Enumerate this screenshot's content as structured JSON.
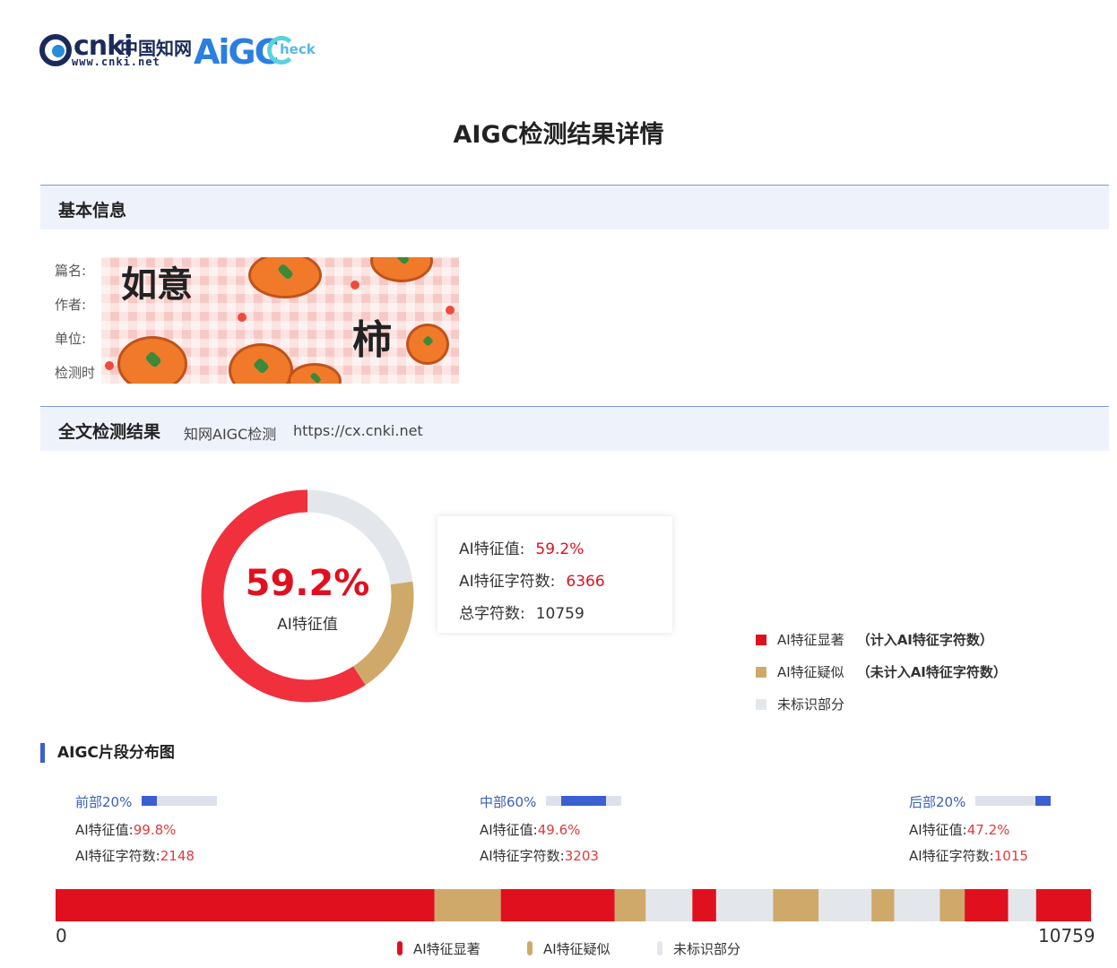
{
  "header": {
    "cnki_text": "cnki",
    "cnki_cn": "中国知网",
    "cnki_url": "www.cnki.net",
    "aigc_logo": "AiGC",
    "check_text": "heck"
  },
  "page_title": "AIGC检测结果详情",
  "basic_info": {
    "section_title": "基本信息",
    "labels": [
      "篇名:",
      "作者:",
      "单位:",
      "检测时"
    ],
    "cover_text": [
      "如意",
      "柿"
    ]
  },
  "full_result": {
    "section_title": "全文检测结果",
    "service_name": "知网AIGC检测",
    "service_url": "https://cx.cnki.net"
  },
  "donut": {
    "center_value": "59.2%",
    "center_label": "AI特征值",
    "segments": [
      {
        "key": "significant",
        "value": 59.2,
        "color": "#f0303c"
      },
      {
        "key": "suspected",
        "value": 18.0,
        "color": "#cfa96a"
      },
      {
        "key": "unmarked",
        "value": 22.8,
        "color": "#e3e6ea"
      }
    ]
  },
  "summary": {
    "ai_value_label": "AI特征值:",
    "ai_value": "59.2%",
    "ai_chars_label": "AI特征字符数:",
    "ai_chars": "6366",
    "total_chars_label": "总字符数:",
    "total_chars": "10759"
  },
  "legend": [
    {
      "label": "AI特征显著",
      "note": "（计入AI特征字符数）",
      "color": "#e0101e"
    },
    {
      "label": "AI特征疑似",
      "note": "（未计入AI特征字符数）",
      "color": "#cfa96a"
    },
    {
      "label": "未标识部分",
      "note": "",
      "color": "#e3e6ea"
    }
  ],
  "distribution": {
    "title": "AIGC片段分布图",
    "segments": [
      {
        "name": "前部20%",
        "ai_value_label": "AI特征值:",
        "ai_value": "99.8%",
        "ai_chars_label": "AI特征字符数:",
        "ai_chars": "2148",
        "fill_start": 0.0,
        "fill_end": 0.2
      },
      {
        "name": "中部60%",
        "ai_value_label": "AI特征值:",
        "ai_value": "49.6%",
        "ai_chars_label": "AI特征字符数:",
        "ai_chars": "3203",
        "fill_start": 0.2,
        "fill_end": 0.8
      },
      {
        "name": "后部20%",
        "ai_value_label": "AI特征值:",
        "ai_value": "47.2%",
        "ai_chars_label": "AI特征字符数:",
        "ai_chars": "1015",
        "fill_start": 0.8,
        "fill_end": 1.0
      }
    ],
    "strip_start": "0",
    "strip_end": "10759",
    "strip_blocks": [
      {
        "type": "significant",
        "from": 0.0,
        "to": 0.366
      },
      {
        "type": "suspected",
        "from": 0.366,
        "to": 0.43
      },
      {
        "type": "significant",
        "from": 0.43,
        "to": 0.54
      },
      {
        "type": "suspected",
        "from": 0.54,
        "to": 0.57
      },
      {
        "type": "unmarked",
        "from": 0.57,
        "to": 0.615
      },
      {
        "type": "significant",
        "from": 0.615,
        "to": 0.638
      },
      {
        "type": "unmarked",
        "from": 0.638,
        "to": 0.693
      },
      {
        "type": "suspected",
        "from": 0.693,
        "to": 0.737
      },
      {
        "type": "unmarked",
        "from": 0.737,
        "to": 0.788
      },
      {
        "type": "suspected",
        "from": 0.788,
        "to": 0.81
      },
      {
        "type": "unmarked",
        "from": 0.81,
        "to": 0.854
      },
      {
        "type": "suspected",
        "from": 0.854,
        "to": 0.878
      },
      {
        "type": "significant",
        "from": 0.878,
        "to": 0.92
      },
      {
        "type": "unmarked",
        "from": 0.92,
        "to": 0.947
      },
      {
        "type": "significant",
        "from": 0.947,
        "to": 1.0
      }
    ],
    "strip_legend": [
      "AI特征显著",
      "AI特征疑似",
      "未标识部分"
    ]
  },
  "colors": {
    "significant": "#e0101e",
    "suspected": "#cfa96a",
    "unmarked": "#e3e6ea"
  }
}
